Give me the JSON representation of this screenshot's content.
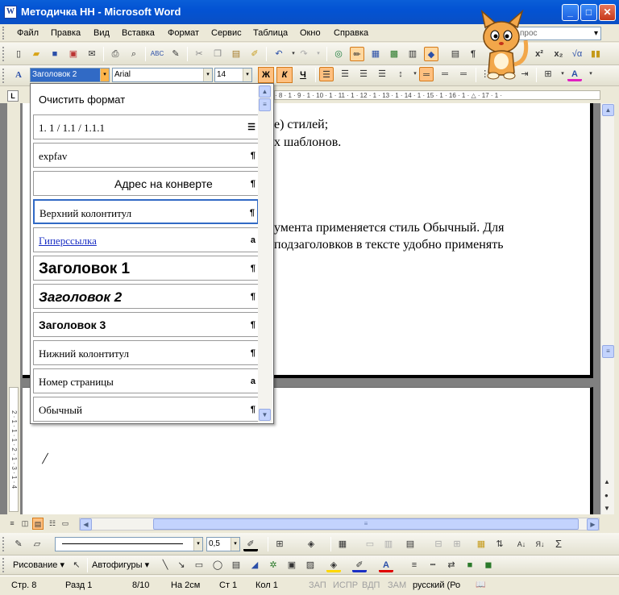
{
  "window": {
    "title": "Методичка НН - Microsoft Word",
    "app_icon": "W",
    "min": "_",
    "max": "□",
    "close": "✕"
  },
  "menu": [
    "Файл",
    "Правка",
    "Вид",
    "Вставка",
    "Формат",
    "Сервис",
    "Таблица",
    "Окно",
    "Справка"
  ],
  "help_box": {
    "text": "прос"
  },
  "formatting": {
    "style": "Заголовок 2",
    "font": "Arial",
    "size": "14",
    "bold": "Ж",
    "italic": "К",
    "underline": "Ч"
  },
  "ruler": {
    "text": "· 8 · 1 · 9 · 1 · 10 · 1 · 11 · 1 · 12 · 1 · 13 · 1 · 14 · 1 · 15 · 1 · 16 · 1 · △ · 17 · 1 ·"
  },
  "vertical_ruler": {
    "text": "2 · 1 · 1 · 1 · 2 · 1 · 3 · 1 · 4"
  },
  "document": {
    "lines": [
      "е) стилей;",
      "х шаблонов.",
      "умента применяется стиль Обычный. Для",
      "подзаголовков в тексте удобно применять"
    ],
    "cursor": "/"
  },
  "style_list": {
    "items": [
      {
        "label": "Очистить формат",
        "mark": ""
      },
      {
        "label": "1.  1 / 1.1 / 1.1.1",
        "mark": "☰"
      },
      {
        "label": "expfav",
        "mark": "¶"
      },
      {
        "label": "Адрес на конверте",
        "mark": "¶"
      },
      {
        "label": "Верхний колонтитул",
        "mark": "¶"
      },
      {
        "label": "Гиперссылка",
        "mark": "a"
      },
      {
        "label": "Заголовок 1",
        "mark": "¶"
      },
      {
        "label": "Заголовок 2",
        "mark": "¶"
      },
      {
        "label": "Заголовок 3",
        "mark": "¶"
      },
      {
        "label": "Нижний колонтитул",
        "mark": "¶"
      },
      {
        "label": "Номер страницы",
        "mark": "a"
      },
      {
        "label": "Обычный",
        "mark": "¶"
      }
    ]
  },
  "drawing": {
    "line_width": "0,5",
    "draw_menu": "Рисование ▾",
    "autoshapes": "Автофигуры ▾",
    "sigma": "Σ"
  },
  "status": {
    "page": "Стр.  8",
    "section": "Разд  1",
    "pages": "8/10",
    "at": "На  2см",
    "line": "Ст  1",
    "col": "Кол  1",
    "rec": "ЗАП",
    "trk": "ИСПР",
    "ext": "ВДП",
    "ovr": "ЗАМ",
    "lang": "русский (Ро"
  }
}
